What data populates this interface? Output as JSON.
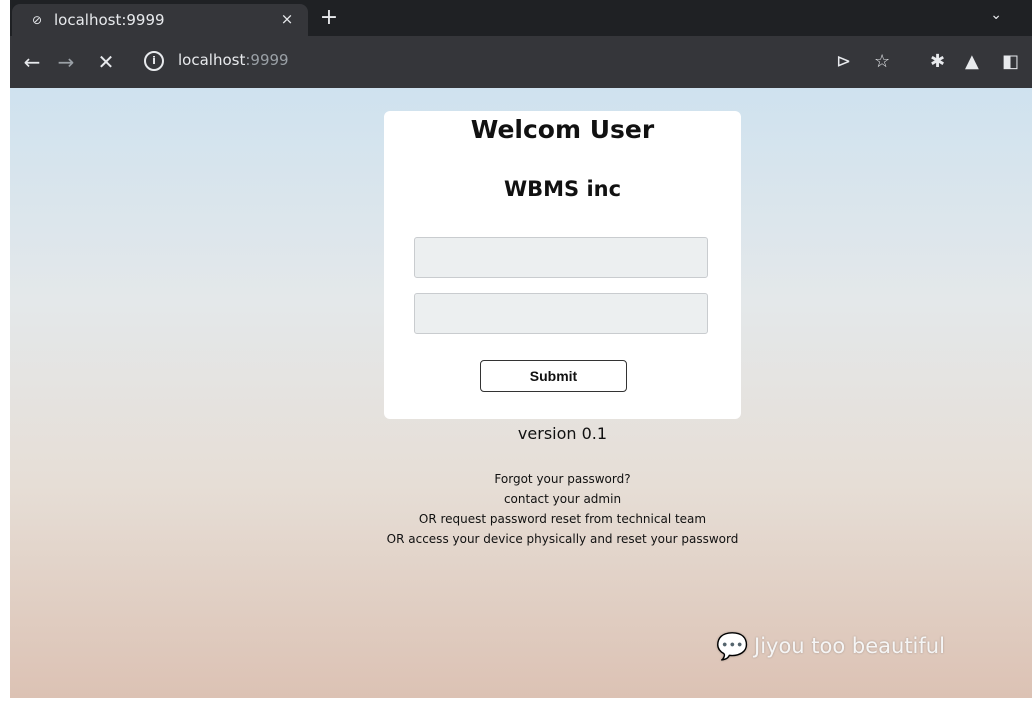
{
  "browser": {
    "tab_title": "localhost:9999",
    "tab_close": "×",
    "new_tab": "+",
    "tab_menu": "⌄",
    "url_host": "localhost",
    "url_port": ":9999",
    "icons": [
      "back-icon",
      "forward-icon",
      "stop-icon",
      "info-icon",
      "send-icon",
      "star-icon",
      "extensions-icon",
      "labs-icon",
      "side-panel-icon"
    ]
  },
  "login": {
    "title": "Welcom User",
    "subtitle": "WBMS inc",
    "username_value": "",
    "password_value": "",
    "submit_label": "Submit"
  },
  "version": "version 0.1",
  "help": {
    "line1": "Forgot your password?",
    "line2": "contact your admin",
    "line3": "OR request password reset from technical team",
    "line4": "OR access your device physically and reset your password"
  },
  "watermark": "Jiyou too beautiful",
  "colors": {
    "chrome_dark": "#1f2124",
    "chrome_toolbar": "#35363a",
    "card_bg": "#ffffff",
    "field_bg": "#eceff0"
  }
}
